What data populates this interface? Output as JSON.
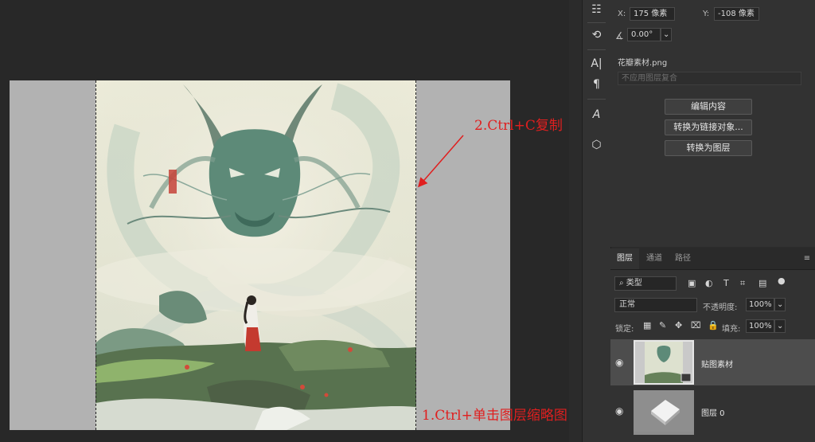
{
  "properties": {
    "x_label": "X:",
    "x_value": "175 像素",
    "y_label": "Y:",
    "y_value": "-108 像素",
    "angle_value": "0.00°",
    "file_name": "花瓣素材.png",
    "layer_comp_placeholder": "不应用图层复合",
    "buttons": [
      "编辑内容",
      "转换为链接对象...",
      "转换为图层"
    ]
  },
  "layers_panel": {
    "tabs": [
      "图层",
      "通道",
      "路径"
    ],
    "active_tab": "图层",
    "filter_label": "类型",
    "blend_mode": "正常",
    "opacity_label": "不透明度:",
    "opacity_value": "100%",
    "lock_label": "锁定:",
    "fill_label": "填充:",
    "fill_value": "100%",
    "layers": [
      {
        "name": "贴图素材",
        "selected": true
      },
      {
        "name": "图层 0",
        "selected": false
      }
    ]
  },
  "annotations": {
    "step1": "1.Ctrl+单击图层缩略图",
    "step2": "2.Ctrl+C复制"
  },
  "colors": {
    "annotation": "#e01f1f",
    "panel_bg": "#323232",
    "canvas_bg": "#282828"
  }
}
